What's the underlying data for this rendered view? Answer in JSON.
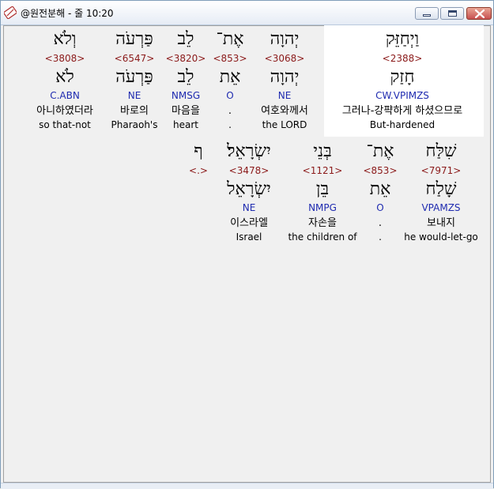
{
  "window": {
    "title": "@원전분해 - 줄 10:20",
    "icons": {
      "app": "bible-app-icon",
      "minimize": "minimize-icon",
      "maximize": "maximize-icon",
      "close": "close-icon"
    }
  },
  "colors": {
    "strong": "#8b1a1a",
    "morph": "#1f2bb0",
    "highlight": "#ffffff"
  },
  "lines": [
    {
      "words": [
        {
          "hebrew": "וַיְחַזֵּק",
          "strong": "<2388>",
          "lemma": "חָזַק",
          "morph": "CW.VPIMZS",
          "korean": "그러나-강퍅하게 하셨으므로",
          "english": "But-hardened",
          "highlighted": true
        },
        {
          "hebrew": "יְהוָה",
          "strong": "<3068>",
          "lemma": "יְהוָה",
          "morph": "NE",
          "korean": "여호와께서",
          "english": "the LORD"
        },
        {
          "hebrew": "אֶת־",
          "strong": "<853>",
          "lemma": "אֵת",
          "morph": "O",
          "korean": ".",
          "english": "."
        },
        {
          "hebrew": "לֵב",
          "strong": "<3820>",
          "lemma": "לֵב",
          "morph": "NMSG",
          "korean": "마음을",
          "english": "heart"
        },
        {
          "hebrew": "פַּרְעֹה",
          "strong": "<6547>",
          "lemma": "פַּרְעֹה",
          "morph": "NE",
          "korean": "바로의",
          "english": "Pharaoh's"
        },
        {
          "hebrew": "וְלֹא",
          "strong": "<3808>",
          "lemma": "לֹא",
          "morph": "C.ABN",
          "korean": "아니하였더라",
          "english": "so that-not"
        }
      ]
    },
    {
      "words": [
        {
          "hebrew": "שִׁלַּח",
          "strong": "<7971>",
          "lemma": "שָׁלַח",
          "morph": "VPAMZS",
          "korean": "보내지",
          "english": "he would-let-go"
        },
        {
          "hebrew": "אֶת־",
          "strong": "<853>",
          "lemma": "אֵת",
          "morph": "O",
          "korean": ".",
          "english": "."
        },
        {
          "hebrew": "בְּנֵי",
          "strong": "<1121>",
          "lemma": "בֵּן",
          "morph": "NMPG",
          "korean": "자손을",
          "english": "the children of"
        },
        {
          "hebrew": "יִשְׂרָאֵל׃",
          "strong": "<3478>",
          "lemma": "יִשְׂרָאֵל",
          "morph": "NE",
          "korean": "이스라엘",
          "english": "Israel"
        },
        {
          "hebrew": "ף",
          "strong": "<.>"
        }
      ]
    }
  ]
}
